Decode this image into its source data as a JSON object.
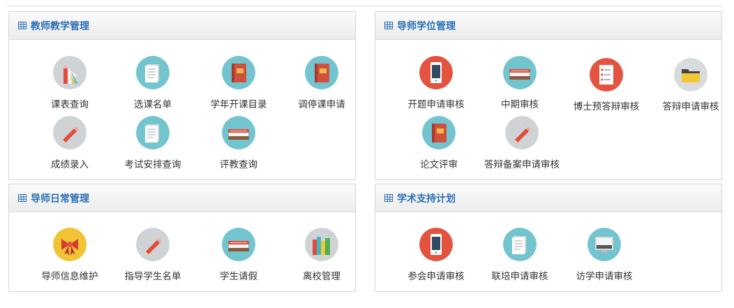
{
  "panels": [
    {
      "title": "教师教学管理",
      "items": [
        {
          "label": "课表查询",
          "icon": "pencils-paper-icon"
        },
        {
          "label": "选课名单",
          "icon": "document-list-icon"
        },
        {
          "label": "学年开课目录",
          "icon": "red-book-icon"
        },
        {
          "label": "调停课申请",
          "icon": "red-book-icon"
        },
        {
          "label": "成绩录入",
          "icon": "pencil-icon"
        },
        {
          "label": "考试安排查询",
          "icon": "document-list-icon"
        },
        {
          "label": "评教查询",
          "icon": "books-stack-icon"
        }
      ]
    },
    {
      "title": "导师学位管理",
      "items": [
        {
          "label": "开题申请审核",
          "icon": "phone-icon"
        },
        {
          "label": "中期审核",
          "icon": "books-stack-icon"
        },
        {
          "label": "博士预答辩审核",
          "icon": "checklist-icon"
        },
        {
          "label": "答辩申请审核",
          "icon": "folder-icon"
        },
        {
          "label": "论文评审",
          "icon": "red-book-icon"
        },
        {
          "label": "答辩备案申请审核",
          "icon": "pencil-icon"
        }
      ]
    },
    {
      "title": "导师日常管理",
      "items": [
        {
          "label": "导师信息维护",
          "icon": "ribbon-bow-icon"
        },
        {
          "label": "指导学生名单",
          "icon": "pencil-icon"
        },
        {
          "label": "学生请假",
          "icon": "books-stack-icon"
        },
        {
          "label": "离校管理",
          "icon": "book-spines-icon"
        }
      ]
    },
    {
      "title": "学术支持计划",
      "items": [
        {
          "label": "参会申请审核",
          "icon": "phone-icon"
        },
        {
          "label": "联培申请审核",
          "icon": "document-list-icon"
        },
        {
          "label": "访学申请审核",
          "icon": "monitor-icon"
        }
      ]
    }
  ]
}
